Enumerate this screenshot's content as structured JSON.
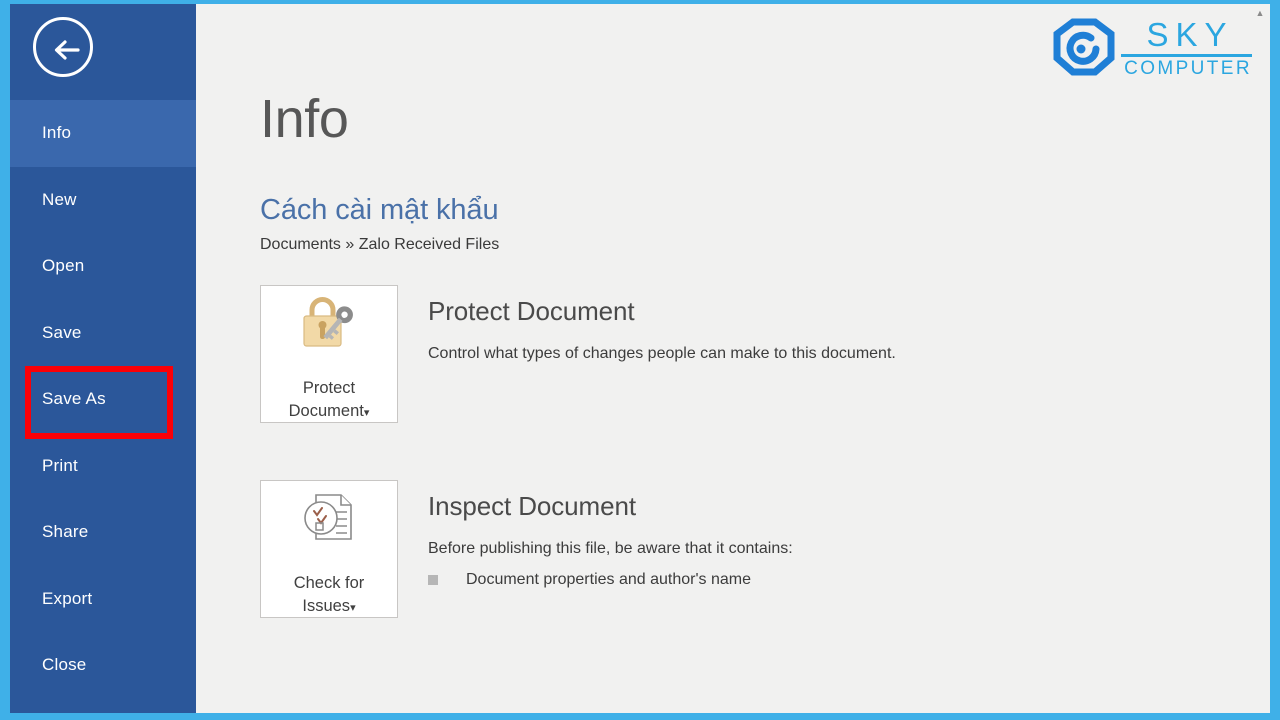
{
  "window": {
    "frame_color": "#3fb0e8",
    "backstage_bg": "#f1f1f0"
  },
  "nav": {
    "back_label": "Back",
    "rail_color": "#2b579a",
    "selected_color": "#3a68ad",
    "items": [
      {
        "label": "Info",
        "selected": true,
        "highlighted": false
      },
      {
        "label": "New",
        "selected": false,
        "highlighted": false
      },
      {
        "label": "Open",
        "selected": false,
        "highlighted": false
      },
      {
        "label": "Save",
        "selected": false,
        "highlighted": false
      },
      {
        "label": "Save As",
        "selected": false,
        "highlighted": true
      },
      {
        "label": "Print",
        "selected": false,
        "highlighted": false
      },
      {
        "label": "Share",
        "selected": false,
        "highlighted": false
      },
      {
        "label": "Export",
        "selected": false,
        "highlighted": false
      },
      {
        "label": "Close",
        "selected": false,
        "highlighted": false
      }
    ],
    "highlight_color": "#fb0007"
  },
  "main": {
    "page_title": "Info",
    "document_name": "Cách cài mật khẩu",
    "document_path": "Documents » Zalo Received Files",
    "protect": {
      "button_label": "Protect\nDocument",
      "button_caret": "▾",
      "icon": "padlock-key-icon",
      "heading": "Protect Document",
      "description": "Control what types of changes people can make to this document."
    },
    "inspect": {
      "button_label": "Check for\nIssues",
      "button_caret": "▾",
      "icon": "document-check-icon",
      "heading": "Inspect Document",
      "description": "Before publishing this file, be aware that it contains:",
      "bullets": [
        "Document properties and author's name"
      ]
    },
    "scroll_up_glyph": "▲"
  },
  "logo": {
    "name_top": "SKY",
    "name_bottom": "COMPUTER",
    "color": "#2ba6e0"
  }
}
